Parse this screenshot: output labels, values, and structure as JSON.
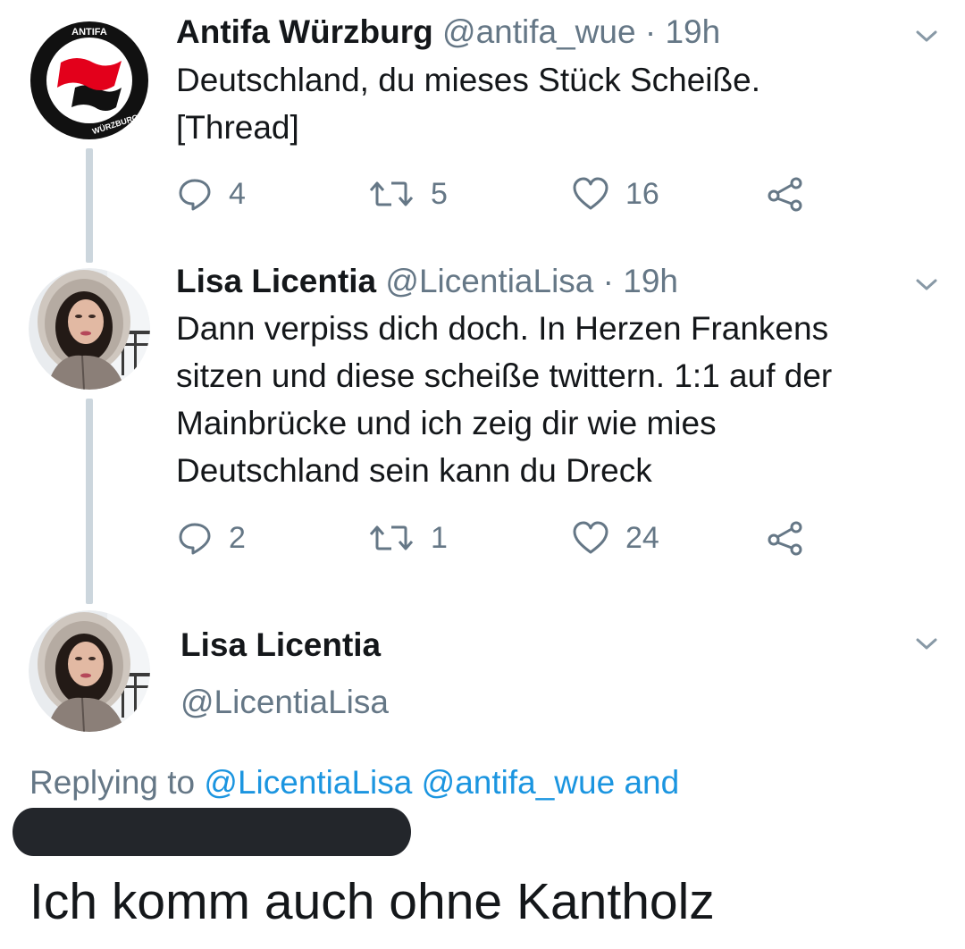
{
  "tweets": [
    {
      "name": "Antifa Würzburg",
      "handle": "@antifa_wue",
      "time": "19h",
      "text": "Deutschland, du mieses Stück Scheiße.\n[Thread]",
      "replies": "4",
      "retweets": "5",
      "likes": "16",
      "avatar": {
        "type": "logo",
        "text_top": "ANTIFA",
        "text_bottom": "WÜRZBURG",
        "colors": {
          "ring": "#111111",
          "flag_red": "#e3001b",
          "flag_black": "#111111",
          "background": "#ffffff"
        }
      }
    },
    {
      "name": "Lisa Licentia",
      "handle": "@LicentiaLisa",
      "time": "19h",
      "text": "Dann verpiss dich doch. In Herzen Frankens sitzen und diese scheiße twittern. 1:1 auf der Mainbrücke und ich zeig dir wie mies Deutschland sein kann du Dreck",
      "replies": "2",
      "retweets": "1",
      "likes": "24",
      "avatar": {
        "type": "photo"
      }
    }
  ],
  "focused_tweet": {
    "name": "Lisa Licentia",
    "handle": "@LicentiaLisa",
    "replying_label": "Replying to",
    "replying_mentions": "@LicentiaLisa @antifa_wue and",
    "text": "Ich komm auch ohne Kantholz",
    "avatar": {
      "type": "photo"
    }
  },
  "icons": {
    "caret": "chevron-down-icon",
    "reply": "reply-icon",
    "retweet": "retweet-icon",
    "like": "heart-icon",
    "share": "share-icon"
  },
  "colors": {
    "link": "#1b95e0",
    "secondary_text": "#657786",
    "thread_line": "#ccd6dd",
    "redaction": "#23262b"
  }
}
